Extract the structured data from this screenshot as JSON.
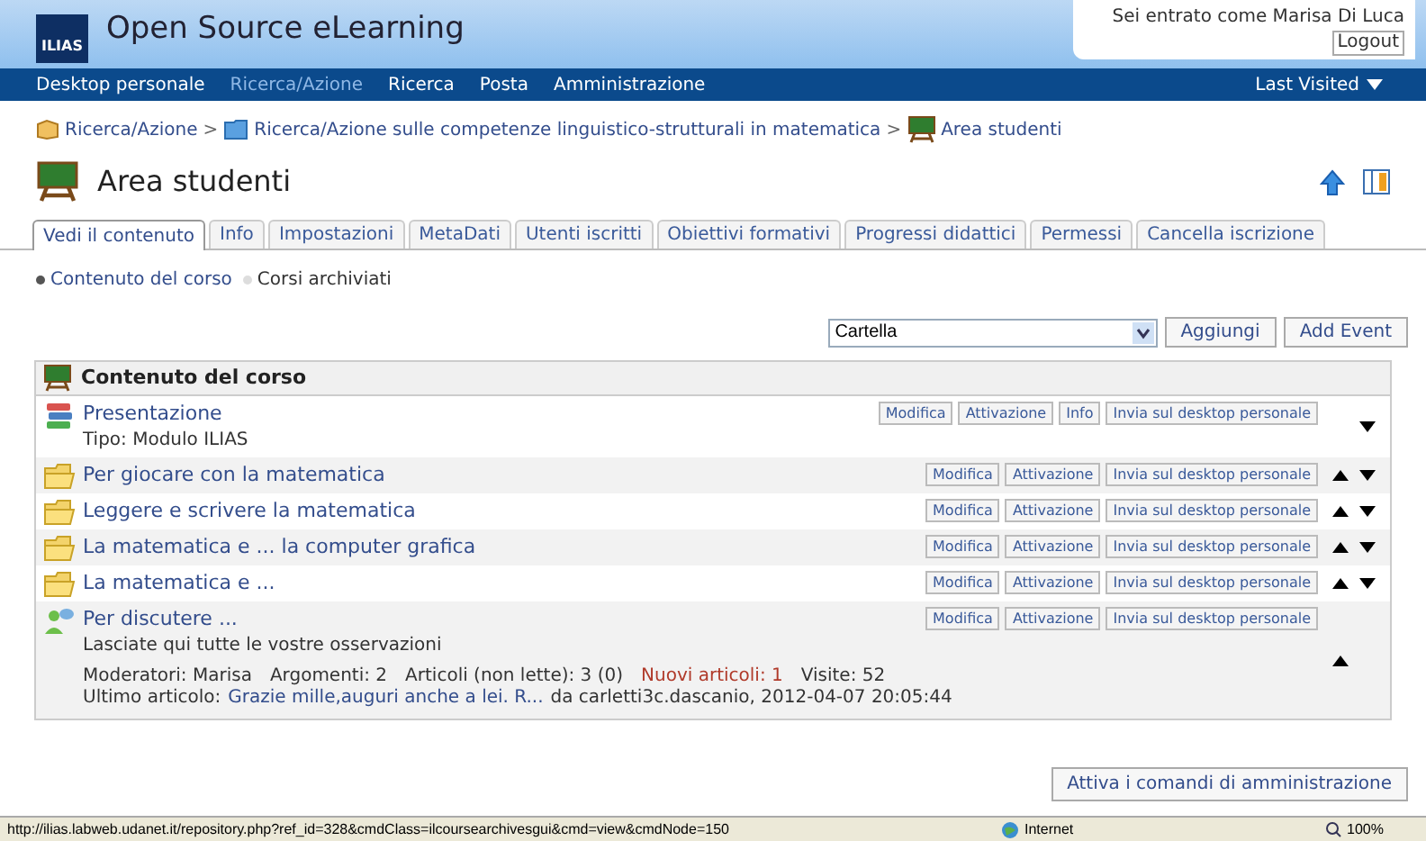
{
  "header": {
    "logo": "ILIAS",
    "title": "Open Source eLearning",
    "user_text": "Sei entrato come Marisa Di Luca",
    "logout": "Logout"
  },
  "nav": {
    "items": [
      {
        "label": "Desktop personale",
        "selected": false
      },
      {
        "label": "Ricerca/Azione",
        "selected": true
      },
      {
        "label": "Ricerca",
        "selected": false
      },
      {
        "label": "Posta",
        "selected": false
      },
      {
        "label": "Amministrazione",
        "selected": false
      }
    ],
    "last_visited": "Last Visited"
  },
  "breadcrumb": [
    {
      "label": "Ricerca/Azione",
      "kind": "category"
    },
    {
      "label": "Ricerca/Azione sulle competenze linguistico-strutturali in matematica",
      "kind": "folder"
    },
    {
      "label": "Area studenti",
      "kind": "course"
    }
  ],
  "separator": ">",
  "page_title": "Area studenti",
  "tabs": [
    {
      "label": "Vedi il contenuto",
      "selected": true
    },
    {
      "label": "Info",
      "selected": false
    },
    {
      "label": "Impostazioni",
      "selected": false
    },
    {
      "label": "MetaDati",
      "selected": false
    },
    {
      "label": "Utenti iscritti",
      "selected": false
    },
    {
      "label": "Obiettivi formativi",
      "selected": false
    },
    {
      "label": "Progressi didattici",
      "selected": false
    },
    {
      "label": "Permessi",
      "selected": false
    },
    {
      "label": "Cancella iscrizione",
      "selected": false
    }
  ],
  "subtabs": [
    {
      "label": "Contenuto del corso",
      "selected": true
    },
    {
      "label": "Corsi archiviati",
      "selected": false
    }
  ],
  "toolbar": {
    "select_value": "Cartella",
    "add_button": "Aggiungi",
    "event_button": "Add Event"
  },
  "panel": {
    "title": "Contenuto del corso",
    "items": [
      {
        "kind": "module",
        "title": "Presentazione",
        "subtitle": "Tipo: Modulo ILIAS",
        "buttons": [
          "Modifica",
          "Attivazione",
          "Info",
          "Invia sul desktop personale"
        ],
        "move_up": false,
        "move_down": true
      },
      {
        "kind": "folder",
        "title": "Per giocare con la matematica",
        "buttons": [
          "Modifica",
          "Attivazione",
          "Invia sul desktop personale"
        ],
        "move_up": true,
        "move_down": true
      },
      {
        "kind": "folder",
        "title": "Leggere e scrivere la matematica",
        "buttons": [
          "Modifica",
          "Attivazione",
          "Invia sul desktop personale"
        ],
        "move_up": true,
        "move_down": true
      },
      {
        "kind": "folder",
        "title": "La matematica e ... la computer grafica",
        "buttons": [
          "Modifica",
          "Attivazione",
          "Invia sul desktop personale"
        ],
        "move_up": true,
        "move_down": true
      },
      {
        "kind": "folder",
        "title": "La matematica e ...",
        "buttons": [
          "Modifica",
          "Attivazione",
          "Invia sul desktop personale"
        ],
        "move_up": true,
        "move_down": true
      },
      {
        "kind": "forum",
        "title": "Per discutere ...",
        "subtitle": "Lasciate qui tutte le vostre osservazioni",
        "buttons": [
          "Modifica",
          "Attivazione",
          "Invia sul desktop personale"
        ],
        "move_up": true,
        "move_down": false,
        "stats": [
          {
            "text": "Moderatori: Marisa",
            "highlight": false
          },
          {
            "text": "Argomenti: 2",
            "highlight": false
          },
          {
            "text": "Articoli (non lette): 3 (0)",
            "highlight": false
          },
          {
            "text": "Nuovi articoli: 1",
            "highlight": true
          },
          {
            "text": "Visite: 52",
            "highlight": false
          }
        ],
        "last_post_label": "Ultimo articolo:",
        "last_post_link": "Grazie mille,auguri anche a lei. R...",
        "last_post_by": "da carletti3c.dascanio, 2012-04-07 20:05:44"
      }
    ]
  },
  "admin_button": "Attiva i comandi di amministrazione",
  "status_bar": {
    "url": "http://ilias.labweb.udanet.it/repository.php?ref_id=328&cmdClass=ilcoursearchivesgui&cmd=view&cmdNode=150",
    "zone": "Internet",
    "zoom": "100%"
  }
}
